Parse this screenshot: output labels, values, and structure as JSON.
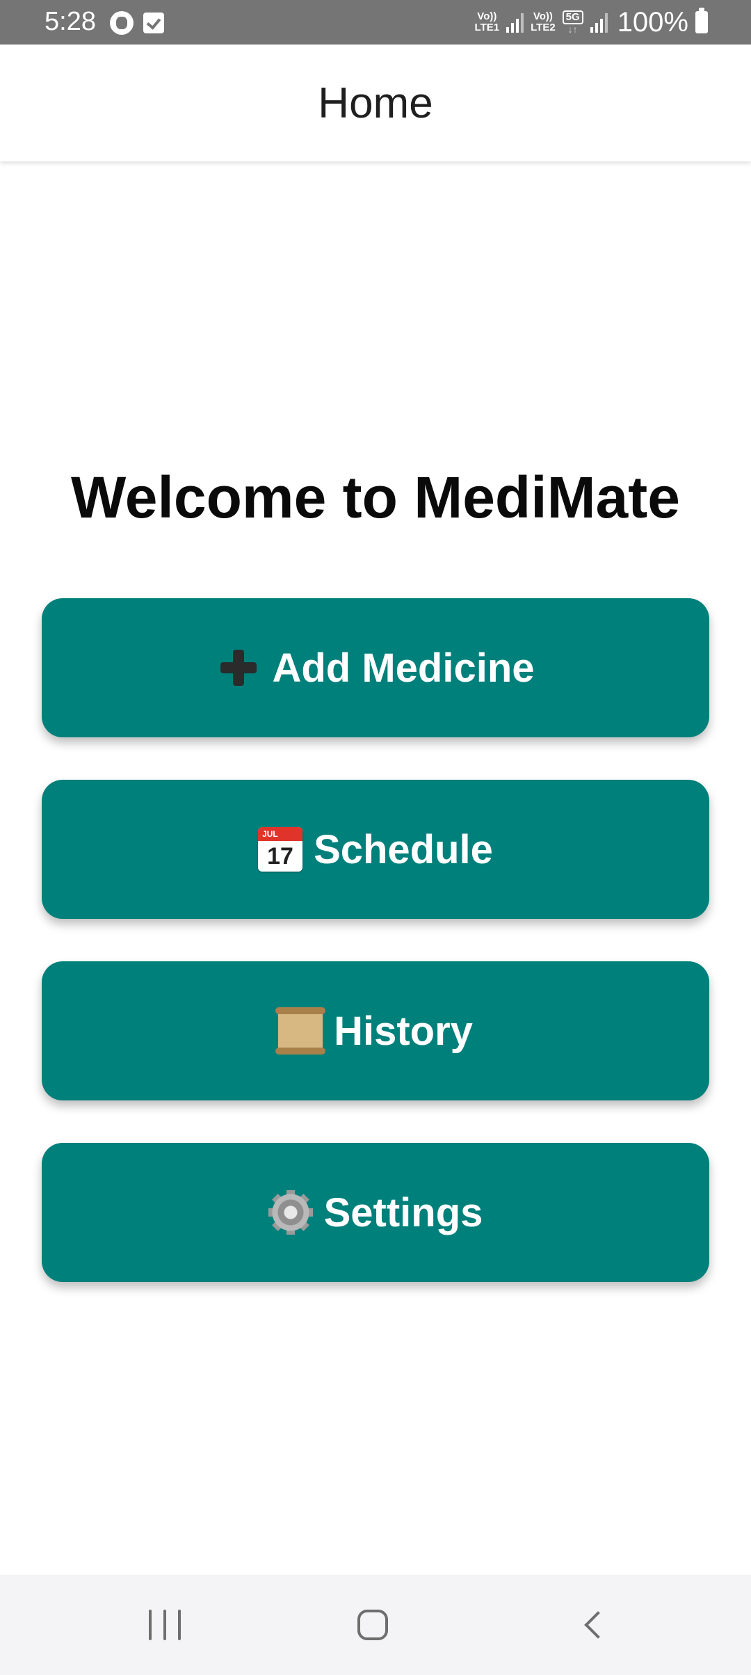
{
  "status_bar": {
    "time": "5:28",
    "sim1_label_top": "Vo))",
    "sim1_label_bottom": "LTE1",
    "sim2_label_top": "Vo))",
    "sim2_label_bottom": "LTE2",
    "network_type": "5G",
    "battery_percent": "100%"
  },
  "app_bar": {
    "title": "Home"
  },
  "main": {
    "welcome_text": "Welcome to MediMate",
    "buttons": [
      {
        "label": "Add Medicine",
        "icon": "plus-icon"
      },
      {
        "label": "Schedule",
        "icon": "calendar-icon",
        "icon_month": "JUL",
        "icon_day": "17"
      },
      {
        "label": "History",
        "icon": "scroll-icon"
      },
      {
        "label": "Settings",
        "icon": "gear-icon"
      }
    ]
  },
  "colors": {
    "button_background": "#00807b",
    "status_bar": "#757575",
    "nav_bar": "#f4f4f6"
  }
}
